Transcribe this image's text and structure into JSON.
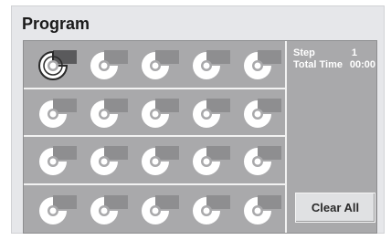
{
  "header": {
    "title": "Program"
  },
  "info": {
    "step_label": "Step",
    "step_value": "1",
    "total_time_label": "Total Time",
    "total_time_value": "00:00"
  },
  "actions": {
    "clear_all_label": "Clear All"
  },
  "slots": {
    "rows": 4,
    "columns": 5,
    "icon": "disc-track-icon",
    "selected_index": 0,
    "colors": {
      "disc": "#ffffff",
      "tab": "#8e8e90",
      "selected_ring": "#2a2a2a",
      "selected_tab": "#5a5a5c"
    }
  }
}
